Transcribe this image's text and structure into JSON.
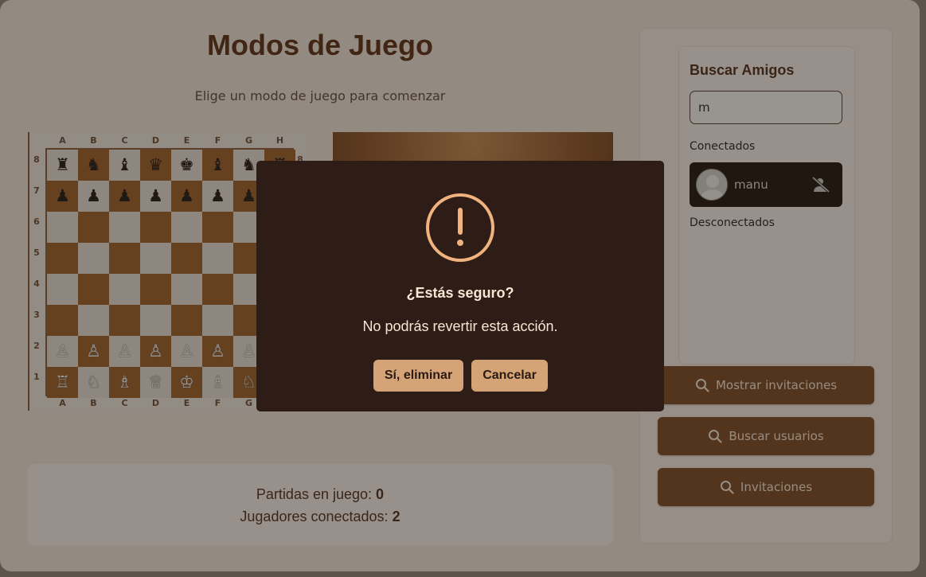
{
  "page": {
    "title": "Modos de Juego",
    "subtitle": "Elige un modo de juego para comenzar"
  },
  "board": {
    "files": [
      "A",
      "B",
      "C",
      "D",
      "E",
      "F",
      "G",
      "H"
    ],
    "ranks": [
      "8",
      "7",
      "6",
      "5",
      "4",
      "3",
      "2",
      "1"
    ],
    "rows": [
      [
        "♜",
        "♞",
        "♝",
        "♛",
        "♚",
        "♝",
        "♞",
        "♜"
      ],
      [
        "♟",
        "♟",
        "♟",
        "♟",
        "♟",
        "♟",
        "♟",
        "♟"
      ],
      [
        "",
        "",
        "",
        "",
        "",
        "",
        "",
        ""
      ],
      [
        "",
        "",
        "",
        "",
        "",
        "",
        "",
        ""
      ],
      [
        "",
        "",
        "",
        "",
        "",
        "",
        "",
        ""
      ],
      [
        "",
        "",
        "",
        "",
        "",
        "",
        "",
        ""
      ],
      [
        "♙",
        "♙",
        "♙",
        "♙",
        "♙",
        "♙",
        "♙",
        "♙"
      ],
      [
        "♖",
        "♘",
        "♗",
        "♕",
        "♔",
        "♗",
        "♘",
        "♖"
      ]
    ]
  },
  "stats": {
    "games_label": "Partidas en juego:",
    "games_value": "0",
    "players_label": "Jugadores conectados:",
    "players_value": "2"
  },
  "friends": {
    "title": "Buscar Amigos",
    "search_value": "m",
    "connected_label": "Conectados",
    "disconnected_label": "Desconectados",
    "connected": [
      {
        "name": "manu",
        "icon": "user-slash-icon"
      }
    ]
  },
  "actions": {
    "show_invitations": "Mostrar invitaciones",
    "search_users": "Buscar usuarios",
    "invitations": "Invitaciones",
    "icon": "search-icon"
  },
  "modal": {
    "icon": "warning-icon",
    "title": "¿Estás seguro?",
    "text": "No podrás revertir esta acción.",
    "confirm": "Sí, eliminar",
    "cancel": "Cancelar"
  },
  "colors": {
    "accent": "#7b4a26",
    "modal_bg": "#2e1c16",
    "modal_button": "#d4a477",
    "warning": "#f0b27f"
  }
}
